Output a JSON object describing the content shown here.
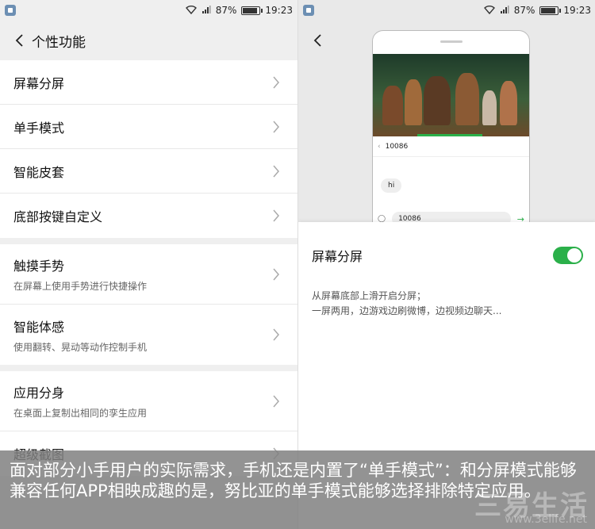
{
  "status": {
    "battery": "87%",
    "battery_level": 0.87,
    "time": "19:23"
  },
  "left": {
    "title": "个性功能",
    "groups": [
      {
        "items": [
          {
            "label": "屏幕分屏"
          },
          {
            "label": "单手模式"
          },
          {
            "label": "智能皮套"
          },
          {
            "label": "底部按键自定义"
          }
        ]
      },
      {
        "items": [
          {
            "label": "触摸手势",
            "sub": "在屏幕上使用手势进行快捷操作"
          },
          {
            "label": "智能体感",
            "sub": "使用翻转、晃动等动作控制手机"
          }
        ]
      },
      {
        "items": [
          {
            "label": "应用分身",
            "sub": "在桌面上复制出相同的孪生应用"
          },
          {
            "label": "超级截图"
          }
        ]
      }
    ]
  },
  "right": {
    "preview": {
      "contact": "10086",
      "bubble": "hi",
      "input": "10086"
    },
    "setting_label": "屏幕分屏",
    "toggle_on": true,
    "desc_line1": "从屏幕底部上滑开启分屏；",
    "desc_line2": "一屏两用，边游戏边刷微博，边视频边聊天..."
  },
  "caption": "面对部分小手用户的实际需求，手机还是内置了“单手模式”：和分屏模式能够兼容任何APP相映成趣的是，努比亚的单手模式能够选择排除特定应用。",
  "watermark": "三易生活",
  "watermark_url": "www.3elife.net",
  "colors": {
    "accent": "#2bb04a",
    "caption_bg": "#808080"
  }
}
